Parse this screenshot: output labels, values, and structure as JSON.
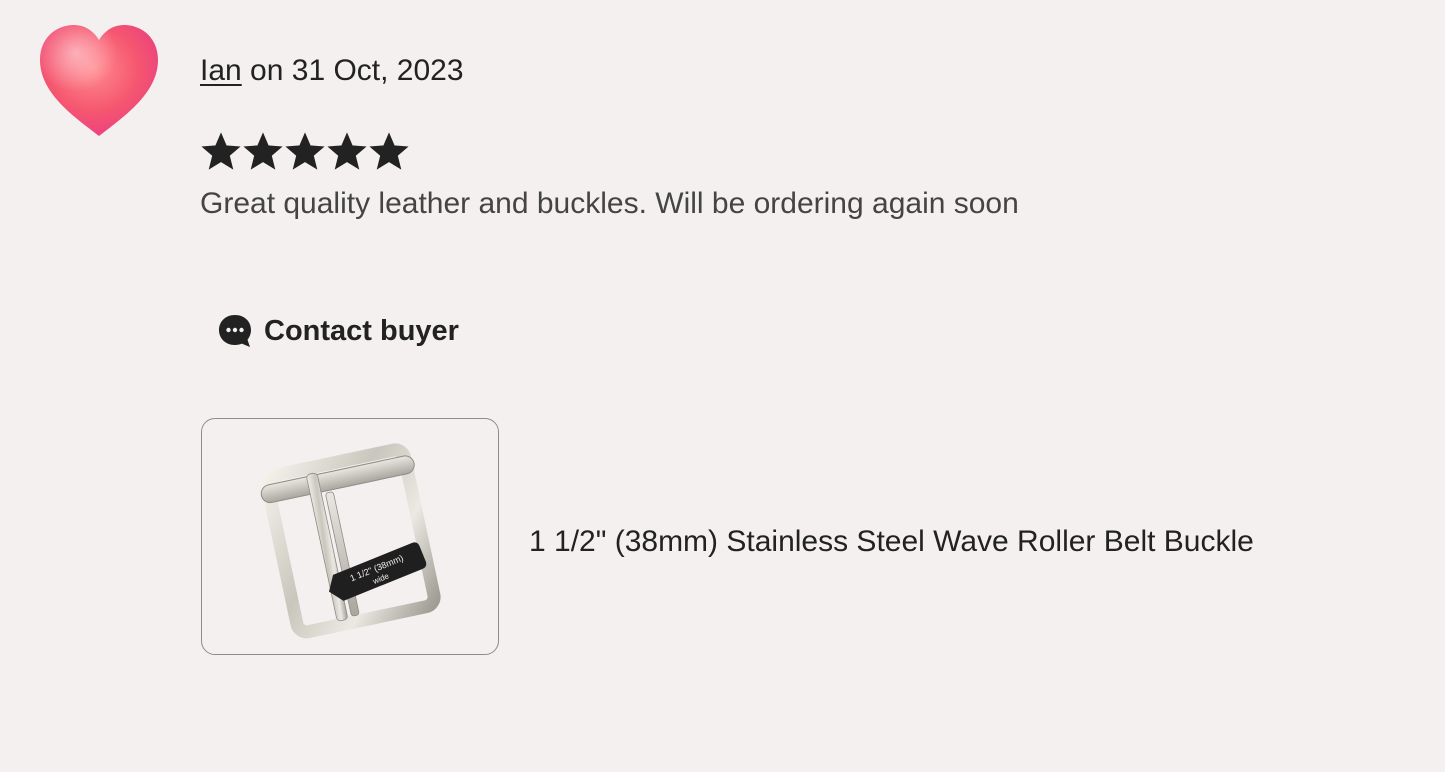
{
  "review": {
    "reviewer_name": "Ian",
    "date_text": " on 31 Oct, 2023",
    "rating": 5,
    "rating_max": 5,
    "text": "Great quality leather and buckles. Will be ordering again soon"
  },
  "actions": {
    "contact_label": "Contact buyer"
  },
  "product": {
    "title": "1 1/2\" (38mm) Stainless Steel Wave Roller Belt Buckle",
    "tag_text_line1": "1 1/2\" (38mm)",
    "tag_text_line2": "wide"
  },
  "colors": {
    "background": "#f4f0ef",
    "text": "#222222",
    "avatar_heart": "#f2546f",
    "star": "#222222"
  },
  "icons": {
    "avatar": "heart-icon",
    "star": "star-icon",
    "contact": "chat-bubble-icon"
  }
}
